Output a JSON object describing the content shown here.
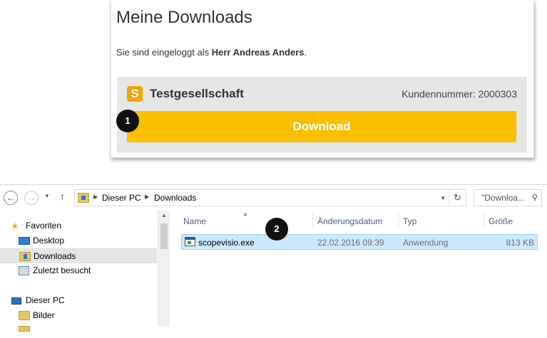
{
  "portal": {
    "title": "Meine Downloads",
    "login_prefix": "Sie sind eingeloggt als ",
    "user": "Herr Andreas Anders",
    "login_suffix": ".",
    "company_logo_letter": "S",
    "company": "Testgesellschaft",
    "customer_number": "Kundennummer: 2000303",
    "download_label": "Download",
    "accent_color": "#f9bf00"
  },
  "markers": {
    "one": "1",
    "two": "2"
  },
  "explorer": {
    "breadcrumb": [
      "Dieser PC",
      "Downloads"
    ],
    "search_placeholder": "\"Downloa...",
    "sidebar": {
      "favorites_label": "Favoriten",
      "favorites": [
        "Desktop",
        "Downloads",
        "Zuletzt besucht"
      ],
      "pc_label": "Dieser PC",
      "pc_items": [
        "Bilder"
      ]
    },
    "columns": [
      "Name",
      "Änderungsdatum",
      "Typ",
      "Größe"
    ],
    "files": [
      {
        "name": "scopevisio.exe",
        "date": "22.02.2016 09:39",
        "type": "Anwendung",
        "size": "813 KB"
      }
    ]
  }
}
